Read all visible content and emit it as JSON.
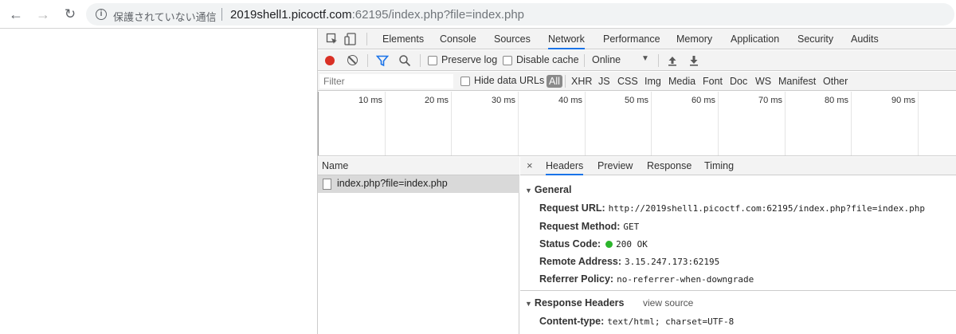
{
  "browser": {
    "back_icon": "←",
    "forward_icon": "→",
    "reload_icon": "↻",
    "security_text": "保護されていない通信",
    "url_host": "2019shell1.picoctf.com",
    "url_rest": ":62195/index.php?file=index.php"
  },
  "devtools": {
    "tabs": [
      "Elements",
      "Console",
      "Sources",
      "Network",
      "Performance",
      "Memory",
      "Application",
      "Security",
      "Audits"
    ],
    "active_tab": "Network",
    "toolbar": {
      "preserve_log": "Preserve log",
      "disable_cache": "Disable cache",
      "throttling": "Online"
    },
    "filter": {
      "placeholder": "Filter",
      "hide_data_urls": "Hide data URLs",
      "types": [
        "All",
        "XHR",
        "JS",
        "CSS",
        "Img",
        "Media",
        "Font",
        "Doc",
        "WS",
        "Manifest",
        "Other"
      ]
    },
    "overview_ticks": [
      "10 ms",
      "20 ms",
      "30 ms",
      "40 ms",
      "50 ms",
      "60 ms",
      "70 ms",
      "80 ms",
      "90 ms"
    ],
    "name_column": {
      "header": "Name",
      "request": "index.php?file=index.php"
    },
    "detail": {
      "close": "×",
      "tabs": [
        "Headers",
        "Preview",
        "Response",
        "Timing"
      ],
      "general_title": "General",
      "general": [
        {
          "key": "Request URL:",
          "value": "http://2019shell1.picoctf.com:62195/index.php?file=index.php"
        },
        {
          "key": "Request Method:",
          "value": "GET"
        },
        {
          "key": "Status Code:",
          "value": "200 OK"
        },
        {
          "key": "Remote Address:",
          "value": "3.15.247.173:62195"
        },
        {
          "key": "Referrer Policy:",
          "value": "no-referrer-when-downgrade"
        }
      ],
      "response_headers_title": "Response Headers",
      "view_source": "view source",
      "response_headers": [
        {
          "key": "Content-type:",
          "value": "text/html; charset=UTF-8"
        }
      ]
    }
  },
  "colors": {
    "record": "#d93025",
    "active_tab_underline": "#1a73e8",
    "status_ok": "#2cb52c"
  }
}
